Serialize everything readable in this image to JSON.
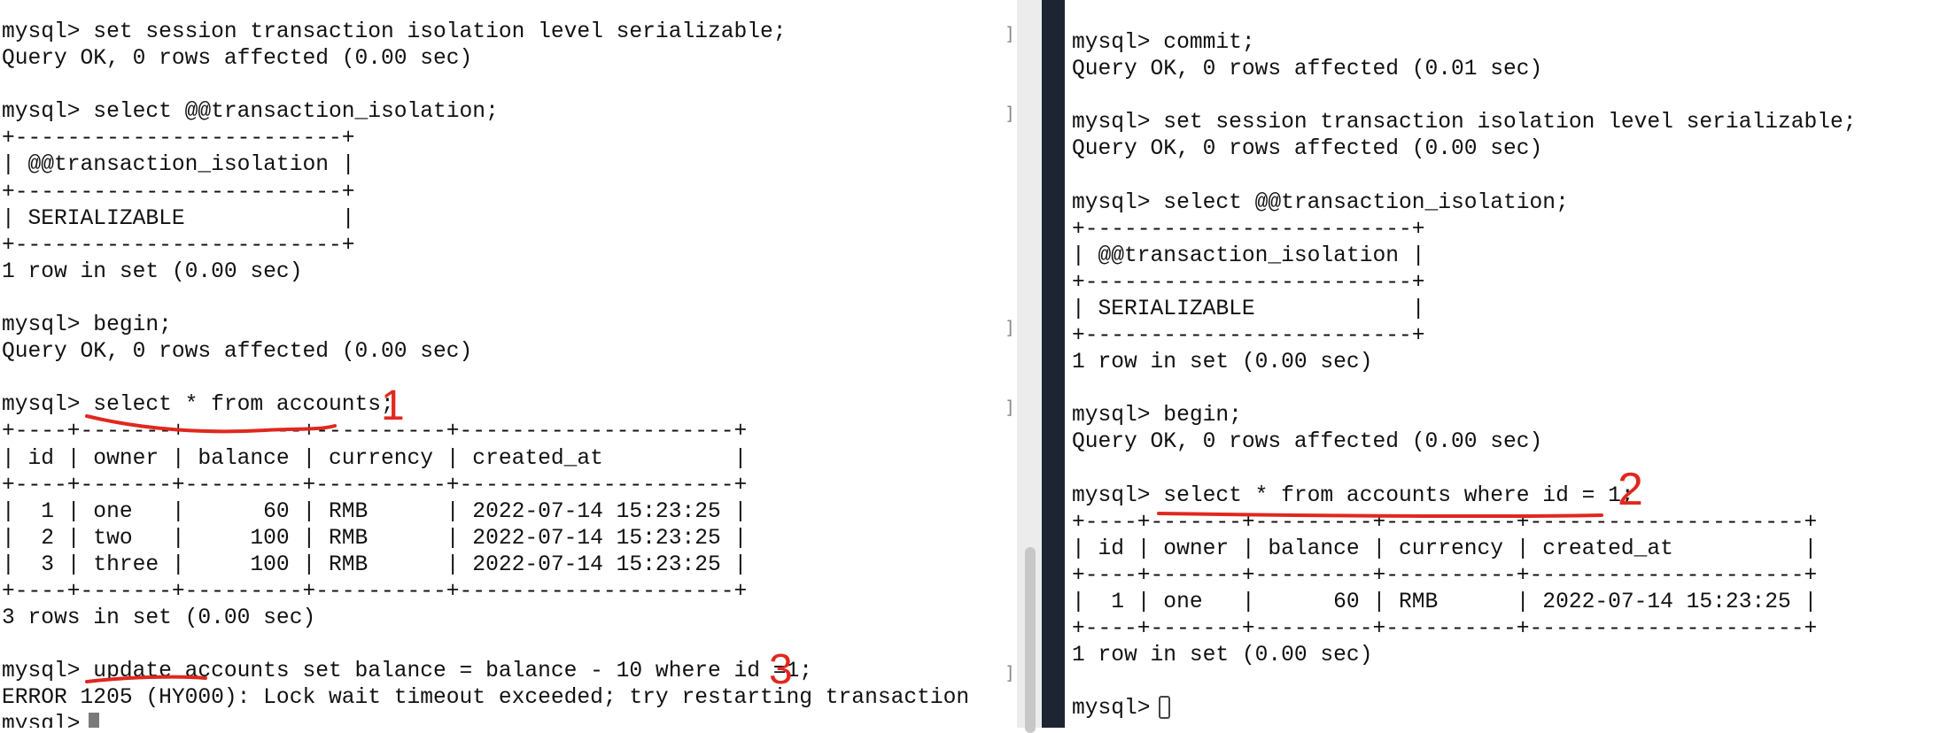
{
  "left_terminal": {
    "lines": [
      "mysql> set session transaction isolation level serializable;",
      "Query OK, 0 rows affected (0.00 sec)",
      "",
      "mysql> select @@transaction_isolation;",
      "+-------------------------+",
      "| @@transaction_isolation |",
      "+-------------------------+",
      "| SERIALIZABLE            |",
      "+-------------------------+",
      "1 row in set (0.00 sec)",
      "",
      "mysql> begin;",
      "Query OK, 0 rows affected (0.00 sec)",
      "",
      "mysql> select * from accounts;",
      "+----+-------+---------+----------+---------------------+",
      "| id | owner | balance | currency | created_at          |",
      "+----+-------+---------+----------+---------------------+",
      "|  1 | one   |      60 | RMB      | 2022-07-14 15:23:25 |",
      "|  2 | two   |     100 | RMB      | 2022-07-14 15:23:25 |",
      "|  3 | three |     100 | RMB      | 2022-07-14 15:23:25 |",
      "+----+-------+---------+----------+---------------------+",
      "3 rows in set (0.00 sec)",
      "",
      "mysql> update accounts set balance = balance - 10 where id =1;",
      "ERROR 1205 (HY000): Lock wait timeout exceeded; try restarting transaction",
      "mysql> "
    ]
  },
  "right_terminal": {
    "lines": [
      "mysql> commit;",
      "Query OK, 0 rows affected (0.01 sec)",
      "",
      "mysql> set session transaction isolation level serializable;",
      "Query OK, 0 rows affected (0.00 sec)",
      "",
      "mysql> select @@transaction_isolation;",
      "+-------------------------+",
      "| @@transaction_isolation |",
      "+-------------------------+",
      "| SERIALIZABLE            |",
      "+-------------------------+",
      "1 row in set (0.00 sec)",
      "",
      "mysql> begin;",
      "Query OK, 0 rows affected (0.00 sec)",
      "",
      "mysql> select * from accounts where id = 1;",
      "+----+-------+---------+----------+---------------------+",
      "| id | owner | balance | currency | created_at          |",
      "+----+-------+---------+----------+---------------------+",
      "|  1 | one   |      60 | RMB      | 2022-07-14 15:23:25 |",
      "+----+-------+---------+----------+---------------------+",
      "1 row in set (0.00 sec)",
      "",
      "mysql> "
    ]
  },
  "annotations": {
    "step1": "1",
    "step2": "2",
    "step3": "3"
  },
  "colors": {
    "annotation": "#e0281f",
    "divider_dark": "#1d2532",
    "text": "#111111"
  }
}
